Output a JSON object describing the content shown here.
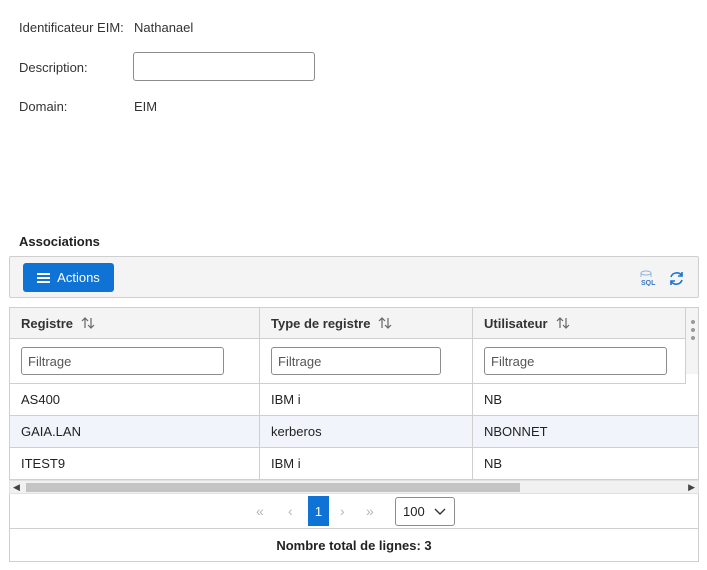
{
  "form": {
    "id_label": "Identificateur EIM:",
    "id_value": "Nathanael",
    "description_label": "Description:",
    "description_value": "",
    "domain_label": "Domain:",
    "domain_value": "EIM"
  },
  "section_title": "Associations",
  "toolbar": {
    "actions_label": "Actions",
    "sql_icon": "sql-icon",
    "refresh_icon": "refresh-icon",
    "accent": "#0f73d6"
  },
  "table": {
    "columns": [
      "Registre",
      "Type de registre",
      "Utilisateur"
    ],
    "filter_placeholder": "Filtrage",
    "rows": [
      [
        "AS400",
        "IBM i",
        "NB"
      ],
      [
        "GAIA.LAN",
        "kerberos",
        "NBONNET"
      ],
      [
        "ITEST9",
        "IBM i",
        "NB"
      ]
    ]
  },
  "pager": {
    "current_page": "1",
    "page_size": "100"
  },
  "footer": {
    "total_label": "Nombre total de lignes: 3"
  }
}
